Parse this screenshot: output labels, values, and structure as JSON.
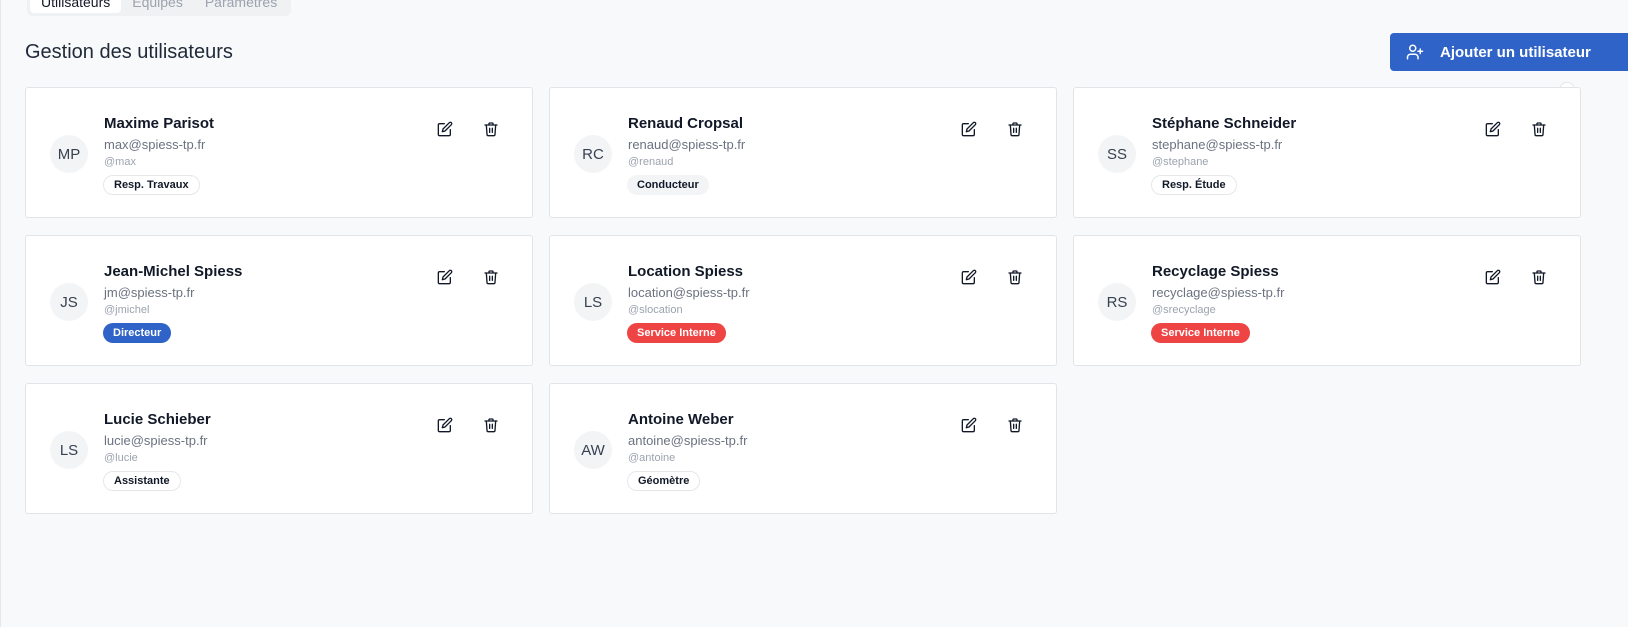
{
  "tabs": [
    {
      "label": "Utilisateurs",
      "active": true
    },
    {
      "label": "Équipes",
      "active": false
    },
    {
      "label": "Paramètres",
      "active": false
    }
  ],
  "page_title": "Gestion des utilisateurs",
  "add_button": {
    "label": "Ajouter un utilisateur",
    "icon": "user-plus-icon",
    "color": "#2f63c8"
  },
  "colors": {
    "primary": "#2f63c8",
    "danger": "#ef4444"
  },
  "users": [
    {
      "initials": "MP",
      "name": "Maxime Parisot",
      "email": "max@spiess-tp.fr",
      "handle": "@max",
      "role": "Resp. Travaux",
      "badge_style": "outline"
    },
    {
      "initials": "RC",
      "name": "Renaud Cropsal",
      "email": "renaud@spiess-tp.fr",
      "handle": "@renaud",
      "role": "Conducteur",
      "badge_style": "gray"
    },
    {
      "initials": "SS",
      "name": "Stéphane Schneider",
      "email": "stephane@spiess-tp.fr",
      "handle": "@stephane",
      "role": "Resp. Étude",
      "badge_style": "outline"
    },
    {
      "initials": "JS",
      "name": "Jean-Michel Spiess",
      "email": "jm@spiess-tp.fr",
      "handle": "@jmichel",
      "role": "Directeur",
      "badge_style": "blue"
    },
    {
      "initials": "LS",
      "name": "Location Spiess",
      "email": "location@spiess-tp.fr",
      "handle": "@slocation",
      "role": "Service Interne",
      "badge_style": "red"
    },
    {
      "initials": "RS",
      "name": "Recyclage Spiess",
      "email": "recyclage@spiess-tp.fr",
      "handle": "@srecyclage",
      "role": "Service Interne",
      "badge_style": "red"
    },
    {
      "initials": "LS",
      "name": "Lucie Schieber",
      "email": "lucie@spiess-tp.fr",
      "handle": "@lucie",
      "role": "Assistante",
      "badge_style": "outline"
    },
    {
      "initials": "AW",
      "name": "Antoine Weber",
      "email": "antoine@spiess-tp.fr",
      "handle": "@antoine",
      "role": "Géomètre",
      "badge_style": "outline"
    }
  ],
  "card_actions": {
    "edit_icon": "edit-icon",
    "delete_icon": "trash-icon"
  }
}
